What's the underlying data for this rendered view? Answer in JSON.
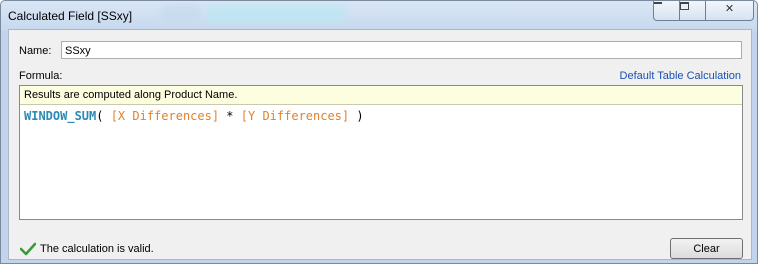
{
  "window": {
    "title": "Calculated Field [SSxy]",
    "minimize_label": "",
    "maximize_label": "",
    "close_label": "✕"
  },
  "form": {
    "name_label": "Name:",
    "name_value": "SSxy",
    "formula_label": "Formula:",
    "default_calc_link": "Default Table Calculation"
  },
  "editor": {
    "notice": "Results are computed along Product Name.",
    "code": {
      "function": "WINDOW_SUM",
      "open": "( ",
      "field1": "[X Differences]",
      "operator": " * ",
      "field2": "[Y Differences]",
      "close": " )"
    },
    "colors": {
      "function": "#2a8ab5",
      "field": "#e0822b"
    }
  },
  "status": {
    "icon": "checkmark-icon",
    "text": "The calculation is valid.",
    "color": "#3a9a3a"
  },
  "buttons": {
    "clear_label": "Clear"
  }
}
